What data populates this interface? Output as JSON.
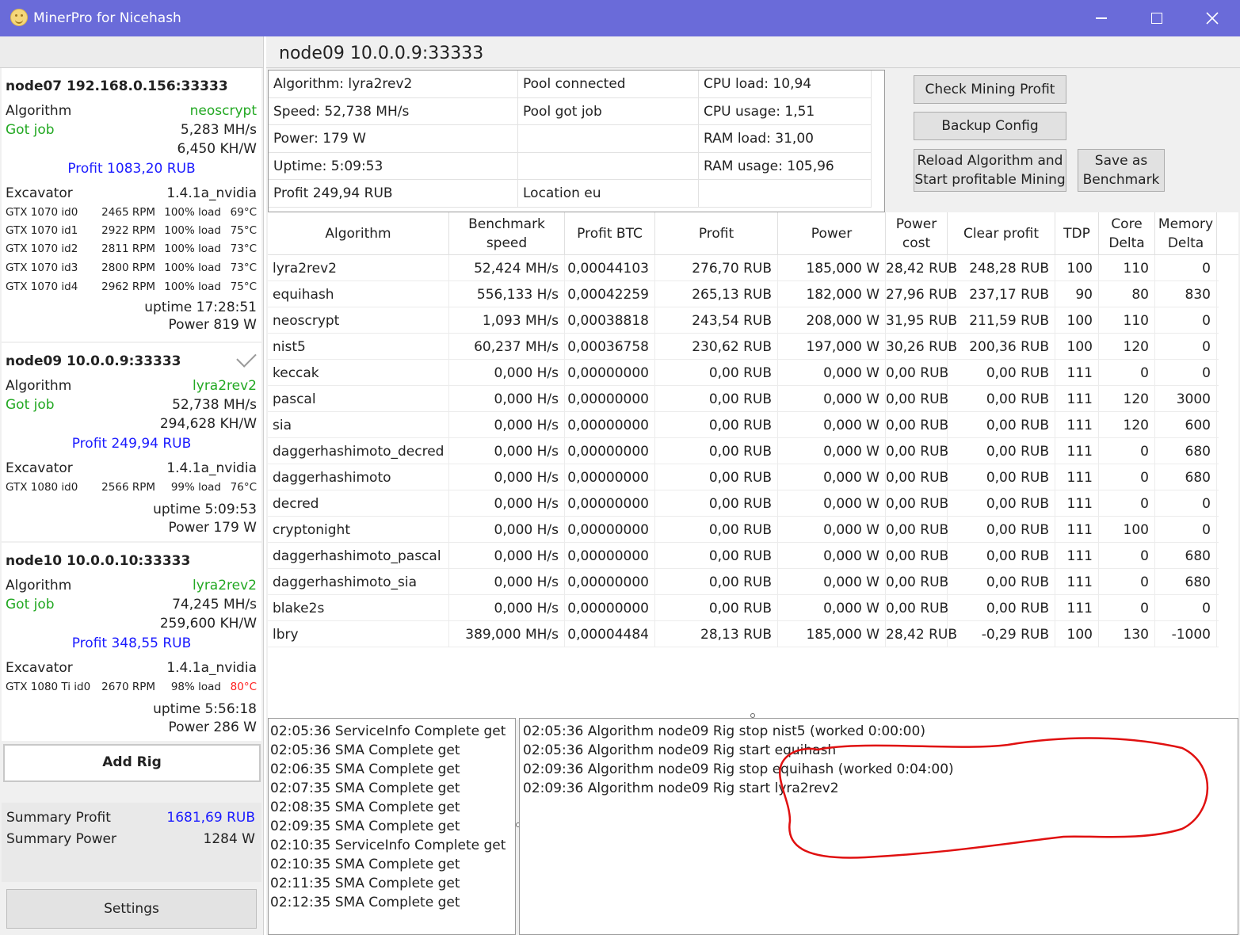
{
  "window": {
    "title": "MinerPro for Nicehash"
  },
  "rigs": [
    {
      "title": "node07 192.168.0.156:33333",
      "algorithm_label": "Algorithm",
      "algorithm": "neoscrypt",
      "status": "Got job",
      "speed": "5,283 MH/s",
      "efficiency": "6,450 KH/W",
      "profit": "Profit 1083,20 RUB",
      "excavator_label": "Excavator",
      "excavator_version": "1.4.1a_nvidia",
      "gpus": [
        {
          "name": "GTX 1070 id0",
          "rpm": "2465 RPM",
          "load": "100% load",
          "temp": "69°C"
        },
        {
          "name": "GTX 1070 id1",
          "rpm": "2922 RPM",
          "load": "100% load",
          "temp": "75°C"
        },
        {
          "name": "GTX 1070 id2",
          "rpm": "2811 RPM",
          "load": "100% load",
          "temp": "73°C"
        },
        {
          "name": "GTX 1070 id3",
          "rpm": "2800 RPM",
          "load": "100% load",
          "temp": "73°C"
        },
        {
          "name": "GTX 1070 id4",
          "rpm": "2962 RPM",
          "load": "100% load",
          "temp": "75°C"
        }
      ],
      "uptime": "uptime 17:28:51",
      "power": "Power 819 W"
    },
    {
      "title": "node09 10.0.0.9:33333",
      "algorithm_label": "Algorithm",
      "algorithm": "lyra2rev2",
      "status": "Got job",
      "speed": "52,738 MH/s",
      "efficiency": "294,628 KH/W",
      "profit": "Profit 249,94 RUB",
      "excavator_label": "Excavator",
      "excavator_version": "1.4.1a_nvidia",
      "gpus": [
        {
          "name": "GTX 1080 id0",
          "rpm": "2566 RPM",
          "load": "99% load",
          "temp": "76°C"
        }
      ],
      "uptime": "uptime 5:09:53",
      "power": "Power 179 W"
    },
    {
      "title": "node10 10.0.0.10:33333",
      "algorithm_label": "Algorithm",
      "algorithm": "lyra2rev2",
      "status": "Got job",
      "speed": "74,245 MH/s",
      "efficiency": "259,600 KH/W",
      "profit": "Profit 348,55 RUB",
      "excavator_label": "Excavator",
      "excavator_version": "1.4.1a_nvidia",
      "gpus": [
        {
          "name": "GTX 1080 Ti id0",
          "rpm": "2670 RPM",
          "load": "98% load",
          "temp": "80°C"
        }
      ],
      "uptime": "uptime 5:56:18",
      "power": "Power 286 W"
    }
  ],
  "add_rig_label": "Add Rig",
  "summary": {
    "profit_label": "Summary Profit",
    "profit_value": "1681,69 RUB",
    "power_label": "Summary Power",
    "power_value": "1284 W"
  },
  "settings_label": "Settings",
  "node": {
    "title": "node09 10.0.0.9:33333",
    "info": [
      [
        "Algorithm: lyra2rev2",
        "Pool connected",
        "CPU load: 10,94"
      ],
      [
        "Speed: 52,738 MH/s",
        "Pool got job",
        "CPU usage: 1,51"
      ],
      [
        "Power: 179 W",
        "",
        "RAM load: 31,00"
      ],
      [
        "Uptime: 5:09:53",
        "",
        "RAM usage: 105,96"
      ],
      [
        "Profit 249,94 RUB",
        "Location eu",
        ""
      ]
    ]
  },
  "actions": {
    "check": "Check Mining Profit",
    "backup": "Backup Config",
    "reload_line1": "Reload Algorithm and",
    "reload_line2": "Start profitable Mining",
    "bench_line1": "Save as",
    "bench_line2": "Benchmark"
  },
  "table": {
    "headers": [
      [
        "Algorithm"
      ],
      [
        "Benchmark",
        "speed"
      ],
      [
        "Profit BTC"
      ],
      [
        "Profit"
      ],
      [
        "Power"
      ],
      [
        "Power cost"
      ],
      [
        "Clear profit"
      ],
      [
        "TDP"
      ],
      [
        "Core",
        "Delta"
      ],
      [
        "Memory",
        "Delta"
      ]
    ],
    "rows": [
      [
        "lyra2rev2",
        "52,424 MH/s",
        "0,00044103",
        "276,70 RUB",
        "185,000 W",
        "28,42 RUB",
        "248,28 RUB",
        "100",
        "110",
        "0"
      ],
      [
        "equihash",
        "556,133 H/s",
        "0,00042259",
        "265,13 RUB",
        "182,000 W",
        "27,96 RUB",
        "237,17 RUB",
        "90",
        "80",
        "830"
      ],
      [
        "neoscrypt",
        "1,093 MH/s",
        "0,00038818",
        "243,54 RUB",
        "208,000 W",
        "31,95 RUB",
        "211,59 RUB",
        "100",
        "110",
        "0"
      ],
      [
        "nist5",
        "60,237 MH/s",
        "0,00036758",
        "230,62 RUB",
        "197,000 W",
        "30,26 RUB",
        "200,36 RUB",
        "100",
        "120",
        "0"
      ],
      [
        "keccak",
        "0,000 H/s",
        "0,00000000",
        "0,00 RUB",
        "0,000 W",
        "0,00 RUB",
        "0,00 RUB",
        "111",
        "0",
        "0"
      ],
      [
        "pascal",
        "0,000 H/s",
        "0,00000000",
        "0,00 RUB",
        "0,000 W",
        "0,00 RUB",
        "0,00 RUB",
        "111",
        "120",
        "3000"
      ],
      [
        "sia",
        "0,000 H/s",
        "0,00000000",
        "0,00 RUB",
        "0,000 W",
        "0,00 RUB",
        "0,00 RUB",
        "111",
        "120",
        "600"
      ],
      [
        "daggerhashimoto_decred",
        "0,000 H/s",
        "0,00000000",
        "0,00 RUB",
        "0,000 W",
        "0,00 RUB",
        "0,00 RUB",
        "111",
        "0",
        "680"
      ],
      [
        "daggerhashimoto",
        "0,000 H/s",
        "0,00000000",
        "0,00 RUB",
        "0,000 W",
        "0,00 RUB",
        "0,00 RUB",
        "111",
        "0",
        "680"
      ],
      [
        "decred",
        "0,000 H/s",
        "0,00000000",
        "0,00 RUB",
        "0,000 W",
        "0,00 RUB",
        "0,00 RUB",
        "111",
        "0",
        "0"
      ],
      [
        "cryptonight",
        "0,000 H/s",
        "0,00000000",
        "0,00 RUB",
        "0,000 W",
        "0,00 RUB",
        "0,00 RUB",
        "111",
        "100",
        "0"
      ],
      [
        "daggerhashimoto_pascal",
        "0,000 H/s",
        "0,00000000",
        "0,00 RUB",
        "0,000 W",
        "0,00 RUB",
        "0,00 RUB",
        "111",
        "0",
        "680"
      ],
      [
        "daggerhashimoto_sia",
        "0,000 H/s",
        "0,00000000",
        "0,00 RUB",
        "0,000 W",
        "0,00 RUB",
        "0,00 RUB",
        "111",
        "0",
        "680"
      ],
      [
        "blake2s",
        "0,000 H/s",
        "0,00000000",
        "0,00 RUB",
        "0,000 W",
        "0,00 RUB",
        "0,00 RUB",
        "111",
        "0",
        "0"
      ],
      [
        "lbry",
        "389,000 MH/s",
        "0,00004484",
        "28,13 RUB",
        "185,000 W",
        "28,42 RUB",
        "-0,29 RUB",
        "100",
        "130",
        "-1000"
      ]
    ]
  },
  "log_service": [
    "02:05:36 ServiceInfo Complete get",
    "02:05:36 SMA Complete get",
    "02:06:35 SMA Complete get",
    "02:07:35 SMA Complete get",
    "02:08:35 SMA Complete get",
    "02:09:35 SMA Complete get",
    "02:10:35 ServiceInfo Complete get",
    "02:10:35 SMA Complete get",
    "02:11:35 SMA Complete get",
    "02:12:35 SMA Complete get"
  ],
  "log_algorithm": [
    "02:05:36 Algorithm node09 Rig stop nist5 (worked 0:00:00)",
    "02:05:36 Algorithm node09 Rig start equihash",
    "02:09:36 Algorithm node09 Rig stop equihash (worked 0:04:00)",
    "02:09:36 Algorithm node09 Rig start lyra2rev2"
  ],
  "colors": {
    "titlebar": "#6a6bd9",
    "status_green": "#22a822",
    "profit_blue": "#1b1bff",
    "hot_temp_red": "#ff1c1c",
    "annotation_red": "#e01010"
  },
  "icons": [
    "app-logo-icon",
    "minimize-icon",
    "maximize-icon",
    "close-icon",
    "checkmark-icon"
  ]
}
